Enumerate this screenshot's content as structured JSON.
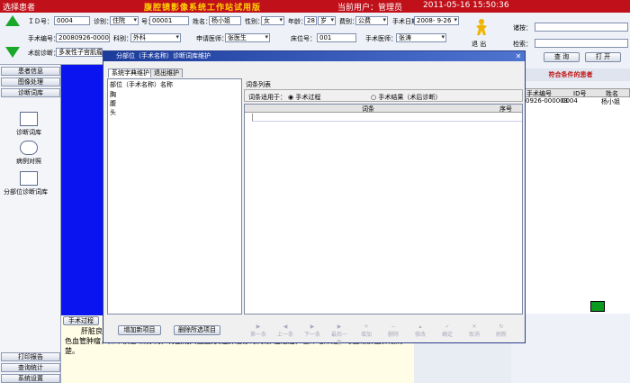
{
  "titlebar": {
    "left_label": "选择患者",
    "app_title": "腹腔镜影像系统工作站试用版",
    "current_user": "当前用户：管理员",
    "datetime": "2011-05-16 15:50:36"
  },
  "form": {
    "id_label": "ＩＤ号：",
    "id_value": "0004",
    "diag_label": "诊别：",
    "diag_value": "住院",
    "no_label": "号：",
    "no_value": "00001",
    "name_label": "姓名：",
    "name_value": "杨小姐",
    "sex_label": "性别：",
    "sex_value": "女",
    "age_label": "年龄：",
    "age_value": "28",
    "age_unit": "岁",
    "fee_label": "费别：",
    "fee_value": "公费",
    "surg_date_label": "手术日期：",
    "surg_date_value": "2008- 9-26",
    "surg_no_label": "手术编号：",
    "surg_no_value": "20080926-000003",
    "dept_label": "科别：",
    "dept_value": "外科",
    "req_doctor_label": "申请医师：",
    "req_doctor_value": "张医生",
    "bed_label": "床位号：",
    "bed_value": "001",
    "surgeon_label": "手术医师：",
    "surgeon_value": "张涛",
    "preop_label": "术前诊断：",
    "preop_value": "多发性子宫肌瘤",
    "extra_value": "腹腔镜下子宫肌瘤剔"
  },
  "toolbar": {
    "exit_label": "退 出"
  },
  "right": {
    "cond_label": "诸按：",
    "search_label": "检索：",
    "query_btn": "查 询",
    "open_btn": "打 开",
    "results_title": "符合条件的患者",
    "cols": [
      "手术编号",
      "ID号",
      "姓名"
    ],
    "row": [
      "0926-000003",
      "0004",
      "杨小姐"
    ]
  },
  "leftnav": {
    "patient_info": "患者信息",
    "image_proc": "图像处理",
    "diag_vocab": "诊断词库",
    "item1": "诊断词库",
    "item2": "病例对照",
    "item3": "分部位诊断词库",
    "print": "打印报告",
    "stats": "查询统计",
    "settings": "系统设置"
  },
  "modal": {
    "title": "分部位（手术名称）诊断词库维护",
    "tab1": "系统字典维护",
    "tab2": "退出维护",
    "left_header": "部位（手术名称）名称",
    "list": [
      "胸",
      "腹",
      "头"
    ],
    "vocab_list_label": "词条列表",
    "applies_label": "词条适用于：",
    "radio1": "手术过程",
    "radio2": "手术结果（术后诊断）",
    "col_entry": "词条",
    "col_seq": "序号",
    "add_btn": "增加新项目",
    "del_btn": "删除所选项目",
    "nav": [
      "第一条",
      "上一条",
      "下一条",
      "最后一条",
      "增加",
      "删除",
      "修改",
      "确定",
      "取消",
      "刷新"
    ]
  },
  "bottom": {
    "prefix": "肝脏良性",
    "text": "色血管肿瘤，如不慎冒 目穿刺，将酿成大出血,良性肿瘤亦为周限 性隆起，色泽略深红，与正常肝面界限清楚。",
    "btn": "手术过程"
  }
}
